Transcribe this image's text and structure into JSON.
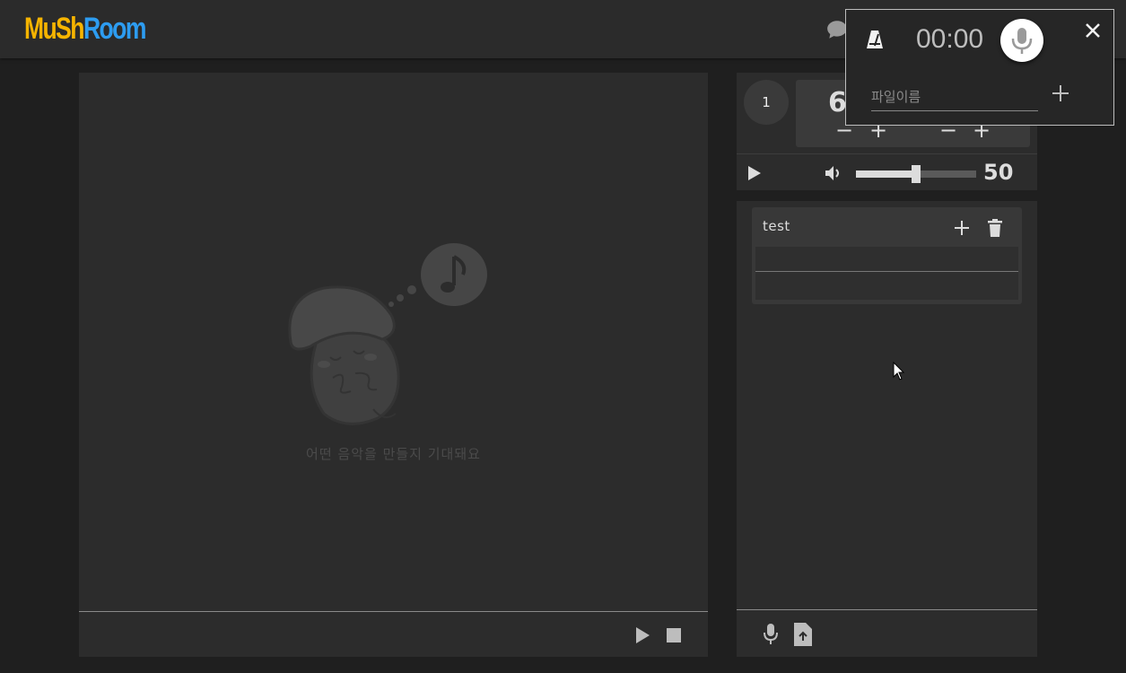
{
  "header": {
    "logo_part1": "MuSh",
    "logo_part2": "Room",
    "chat_icon": "chat-icon"
  },
  "main": {
    "placeholder_text": "어떤 음악을 만들지 기대돼요",
    "controls": {
      "play_icon": "play-icon",
      "stop_icon": "stop-icon"
    }
  },
  "track_settings": {
    "track_number": "1",
    "bpm_value_partial": "6",
    "minus_label": "−",
    "plus_label": "+",
    "volume_value": "50",
    "volume_level": 0.5
  },
  "tracks": [
    {
      "name": "test"
    }
  ],
  "recorder": {
    "timer": "00:00",
    "filename_placeholder": "파일이름",
    "filename_value": ""
  },
  "colors": {
    "logo_yellow": "#f6b400",
    "logo_blue": "#2d9cf0",
    "panel_bg": "#2c2c2c",
    "page_bg": "#1f1f1f"
  }
}
